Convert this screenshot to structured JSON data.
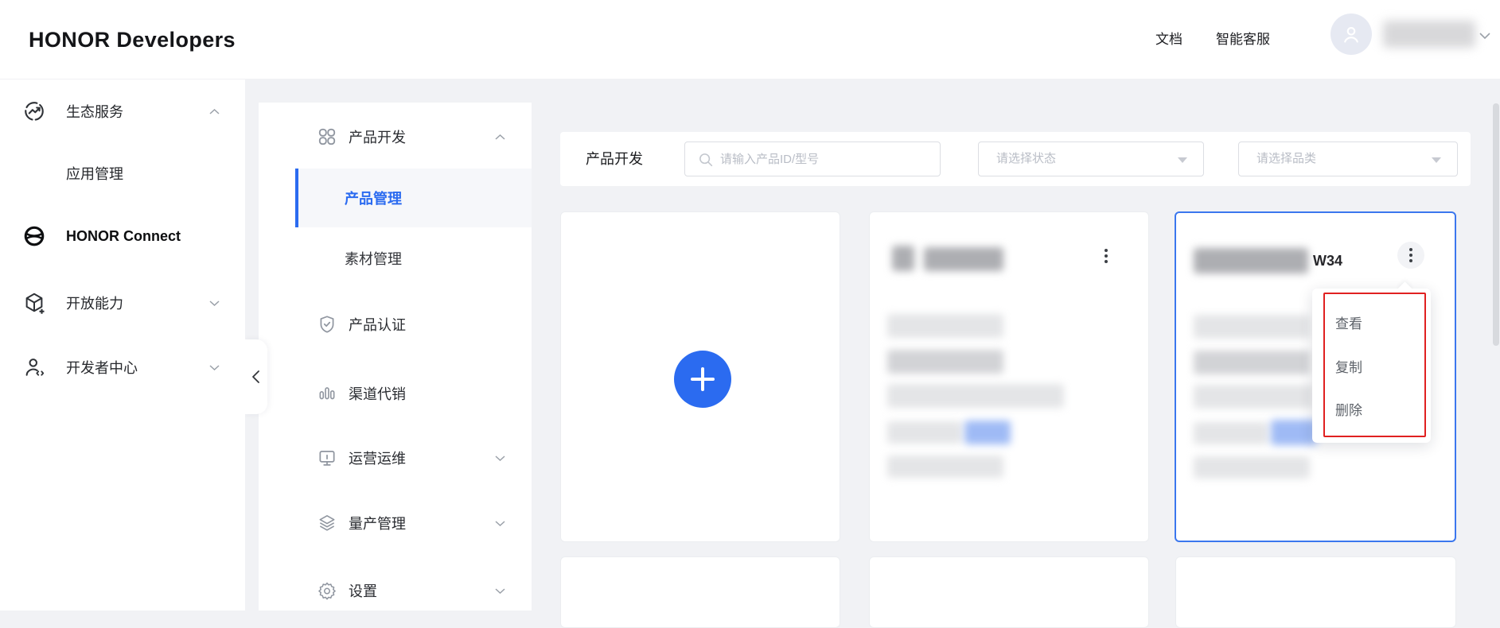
{
  "header": {
    "logo": "HONOR Developers",
    "links": [
      {
        "label": "文档"
      },
      {
        "label": "智能客服"
      }
    ]
  },
  "sidebar": {
    "items": [
      {
        "label": "生态服务",
        "state": "expanded"
      },
      {
        "label": "应用管理",
        "state": "subitem"
      },
      {
        "label": "HONOR Connect",
        "state": "active-bold"
      },
      {
        "label": "开放能力",
        "state": "collapsed"
      },
      {
        "label": "开发者中心",
        "state": "collapsed"
      }
    ]
  },
  "subnav": {
    "items": [
      {
        "label": "产品开发",
        "state": "expanded-group"
      },
      {
        "label": "产品管理",
        "state": "active"
      },
      {
        "label": "素材管理",
        "state": "plain"
      },
      {
        "label": "产品认证",
        "state": "plain"
      },
      {
        "label": "渠道代销",
        "state": "plain"
      },
      {
        "label": "运营运维",
        "state": "collapsed"
      },
      {
        "label": "量产管理",
        "state": "collapsed"
      },
      {
        "label": "设置",
        "state": "collapsed"
      }
    ]
  },
  "filterbar": {
    "title": "产品开发",
    "search_placeholder": "请输入产品ID/型号",
    "status_placeholder": "请选择状态",
    "category_placeholder": "请选择品类"
  },
  "cards": {
    "selected_product_title_visible": "W34"
  },
  "context_menu": {
    "items": [
      {
        "label": "查看"
      },
      {
        "label": "复制"
      },
      {
        "label": "删除"
      }
    ]
  },
  "colors": {
    "accent_blue": "#2b6bf0",
    "selected_card_border": "#3b77ee",
    "annotation_red": "#e02020",
    "page_background": "#f1f2f5"
  },
  "icons": {
    "plus": "+",
    "kebab_vertical": "⋮",
    "search": "🔍",
    "chevron_up": "∧",
    "chevron_down": "∨",
    "chevron_left": "‹",
    "caret_down": "▼"
  }
}
